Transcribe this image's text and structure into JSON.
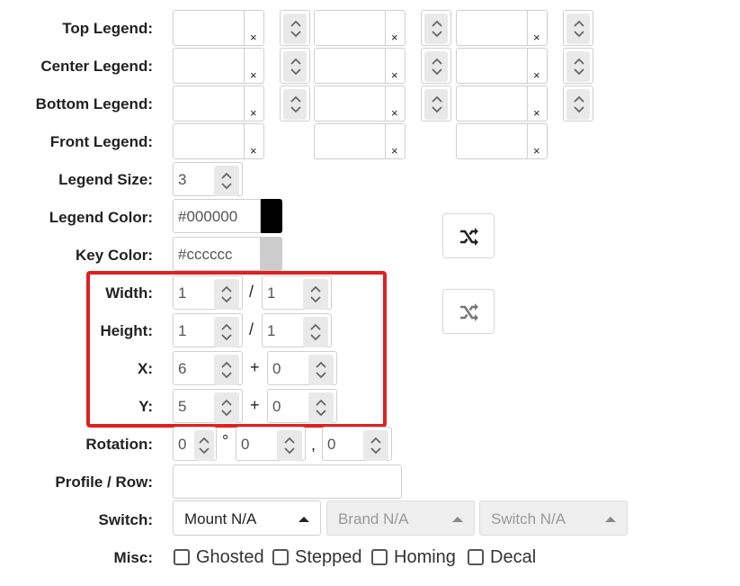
{
  "labels": {
    "top_legend": "Top Legend:",
    "center_legend": "Center Legend:",
    "bottom_legend": "Bottom Legend:",
    "front_legend": "Front Legend:",
    "legend_size": "Legend Size:",
    "legend_color": "Legend Color:",
    "key_color": "Key Color:",
    "width": "Width:",
    "height": "Height:",
    "x": "X:",
    "y": "Y:",
    "rotation": "Rotation:",
    "profile_row": "Profile / Row:",
    "switch": "Switch:",
    "misc": "Misc:"
  },
  "clear_glyph": "×",
  "legend_size": {
    "value": "3"
  },
  "legend_color": {
    "value": "#000000",
    "swatch": "#000000"
  },
  "key_color": {
    "value": "#cccccc",
    "swatch": "#cccccc"
  },
  "width": {
    "value": "1",
    "secondary": "1",
    "separator": "/"
  },
  "height": {
    "value": "1",
    "secondary": "1",
    "separator": "/"
  },
  "x": {
    "value": "6",
    "offset": "0",
    "separator": "+"
  },
  "y": {
    "value": "5",
    "offset": "0",
    "separator": "+"
  },
  "rotation": {
    "angle": "0",
    "degree_symbol": "°",
    "rx": "0",
    "comma": ",",
    "ry": "0"
  },
  "profile_row": {
    "value": ""
  },
  "switch": {
    "mount": {
      "value": "Mount N/A",
      "disabled": false
    },
    "brand": {
      "value": "Brand N/A",
      "disabled": true
    },
    "type": {
      "value": "Switch N/A",
      "disabled": true
    }
  },
  "misc": [
    {
      "label": "Ghosted",
      "checked": false
    },
    {
      "label": "Stepped",
      "checked": false
    },
    {
      "label": "Homing",
      "checked": false
    },
    {
      "label": "Decal",
      "checked": false
    }
  ],
  "icons": {
    "shuffle_color": "shuffle-icon",
    "shuffle_size": "shuffle-icon"
  },
  "colors": {
    "highlight_border": "#e02020",
    "shuffle_active": "#222222",
    "shuffle_inactive": "#777777"
  }
}
